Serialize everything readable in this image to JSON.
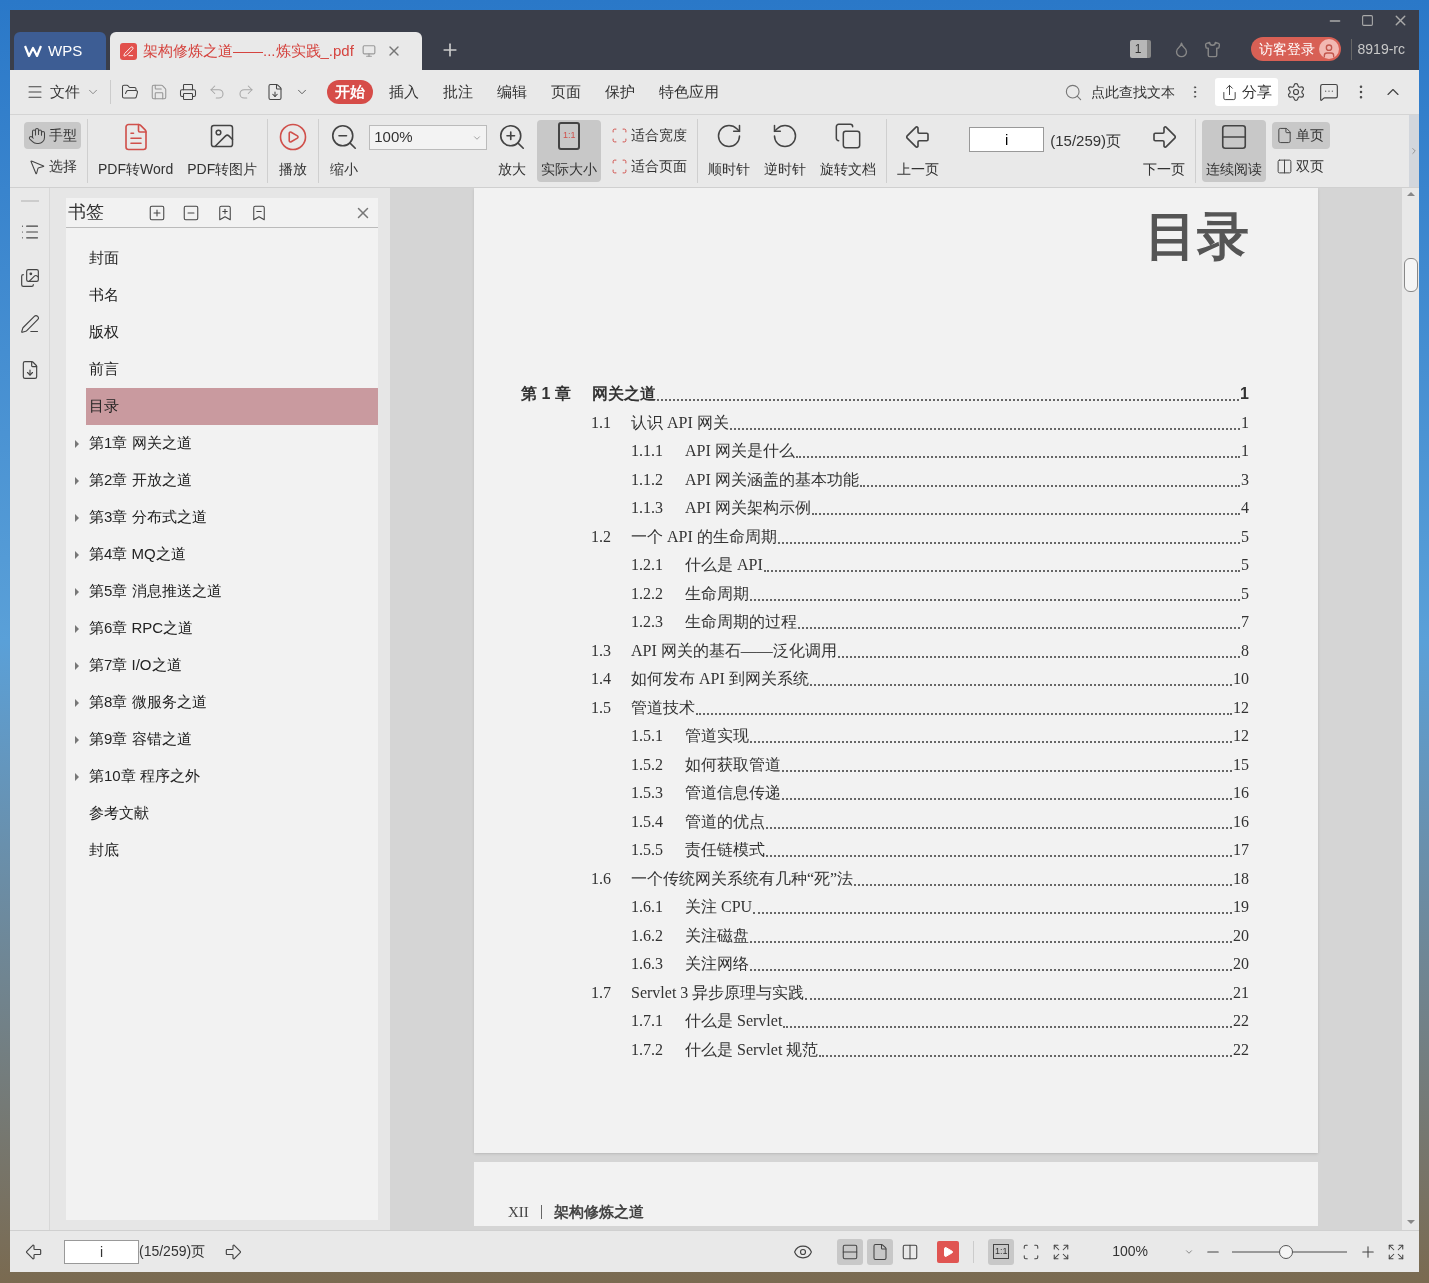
{
  "title_bar": {
    "tabs": [
      {
        "kind": "home",
        "label": "WPS",
        "selected": false
      },
      {
        "kind": "document",
        "label": "架构修炼之道——...炼实践_.pdf",
        "selected": true
      }
    ],
    "badge": "1",
    "login": "访客登录",
    "user": "8919-rc"
  },
  "menu": {
    "file": "文件",
    "tabs": [
      {
        "label": "开始",
        "selected": true
      },
      {
        "label": "插入",
        "selected": false
      },
      {
        "label": "批注",
        "selected": false
      },
      {
        "label": "编辑",
        "selected": false
      },
      {
        "label": "页面",
        "selected": false
      },
      {
        "label": "保护",
        "selected": false
      },
      {
        "label": "特色应用",
        "selected": false
      }
    ],
    "search": {
      "placeholder": "点此查找文本"
    },
    "share": "分享"
  },
  "toolbar": {
    "hand": {
      "label": "手型",
      "selected": true
    },
    "select": {
      "label": "选择",
      "selected": false
    },
    "to_word": "PDF转Word",
    "to_image": "PDF转图片",
    "play": "播放",
    "zoom_out": "缩小",
    "zoom_value": "100%",
    "zoom_in": "放大",
    "actual_size": {
      "label": "实际大小",
      "selected": true,
      "icon_text": "1:1"
    },
    "fit_width": "适合宽度",
    "fit_page": "适合页面",
    "clockwise": "顺时针",
    "counterclockwise": "逆时针",
    "rotate_doc": "旋转文档",
    "prev": "上一页",
    "page_value": "i",
    "page_count": "(15/259)页",
    "next": "下一页",
    "continuous": {
      "label": "连续阅读",
      "selected": true
    },
    "single": {
      "label": "单页",
      "selected": true
    },
    "double": {
      "label": "双页",
      "selected": false
    }
  },
  "bookmarks": {
    "title": "书签",
    "items": [
      {
        "label": "封面",
        "expandable": false,
        "selected": false
      },
      {
        "label": "书名",
        "expandable": false,
        "selected": false
      },
      {
        "label": "版权",
        "expandable": false,
        "selected": false
      },
      {
        "label": "前言",
        "expandable": false,
        "selected": false
      },
      {
        "label": "目录",
        "expandable": false,
        "selected": true
      },
      {
        "label": "第1章 网关之道",
        "expandable": true,
        "selected": false
      },
      {
        "label": "第2章 开放之道",
        "expandable": true,
        "selected": false
      },
      {
        "label": "第3章 分布式之道",
        "expandable": true,
        "selected": false
      },
      {
        "label": "第4章 MQ之道",
        "expandable": true,
        "selected": false
      },
      {
        "label": "第5章 消息推送之道",
        "expandable": true,
        "selected": false
      },
      {
        "label": "第6章 RPC之道",
        "expandable": true,
        "selected": false
      },
      {
        "label": "第7章 I/O之道",
        "expandable": true,
        "selected": false
      },
      {
        "label": "第8章 微服务之道",
        "expandable": true,
        "selected": false
      },
      {
        "label": "第9章 容错之道",
        "expandable": true,
        "selected": false
      },
      {
        "label": "第10章 程序之外",
        "expandable": true,
        "selected": false
      },
      {
        "label": "参考文献",
        "expandable": false,
        "selected": false
      },
      {
        "label": "封底",
        "expandable": false,
        "selected": false
      }
    ]
  },
  "page": {
    "title": "目录",
    "chapter": {
      "number": "第 1 章",
      "title": "网关之道",
      "page": "1",
      "children": [
        {
          "number": "1.1",
          "title": "认识 API 网关",
          "page": "1",
          "children": [
            {
              "number": "1.1.1",
              "title": "API 网关是什么",
              "page": "1"
            },
            {
              "number": "1.1.2",
              "title": "API 网关涵盖的基本功能",
              "page": "3"
            },
            {
              "number": "1.1.3",
              "title": "API 网关架构示例",
              "page": "4"
            }
          ]
        },
        {
          "number": "1.2",
          "title": "一个 API 的生命周期",
          "page": "5",
          "children": [
            {
              "number": "1.2.1",
              "title": "什么是 API",
              "page": "5"
            },
            {
              "number": "1.2.2",
              "title": "生命周期",
              "page": "5"
            },
            {
              "number": "1.2.3",
              "title": "生命周期的过程",
              "page": "7"
            }
          ]
        },
        {
          "number": "1.3",
          "title": "API 网关的基石——泛化调用",
          "page": "8"
        },
        {
          "number": "1.4",
          "title": "如何发布 API 到网关系统",
          "page": "10"
        },
        {
          "number": "1.5",
          "title": "管道技术",
          "page": "12",
          "children": [
            {
              "number": "1.5.1",
              "title": "管道实现",
              "page": "12"
            },
            {
              "number": "1.5.2",
              "title": "如何获取管道",
              "page": "15"
            },
            {
              "number": "1.5.3",
              "title": "管道信息传递",
              "page": "16"
            },
            {
              "number": "1.5.4",
              "title": "管道的优点",
              "page": "16"
            },
            {
              "number": "1.5.5",
              "title": "责任链模式",
              "page": "17"
            }
          ]
        },
        {
          "number": "1.6",
          "title": "一个传统网关系统有几种“死”法",
          "page": "18",
          "children": [
            {
              "number": "1.6.1",
              "title": "关注 CPU",
              "page": "19"
            },
            {
              "number": "1.6.2",
              "title": "关注磁盘",
              "page": "20"
            },
            {
              "number": "1.6.3",
              "title": "关注网络",
              "page": "20"
            }
          ]
        },
        {
          "number": "1.7",
          "title": "Servlet 3 异步原理与实践",
          "page": "21",
          "children": [
            {
              "number": "1.7.1",
              "title": "什么是 Servlet",
              "page": "22"
            },
            {
              "number": "1.7.2",
              "title": "什么是 Servlet 规范",
              "page": "22"
            }
          ]
        }
      ]
    }
  },
  "next_page": {
    "folio": "XII",
    "book_title": "架构修炼之道"
  },
  "status_bar": {
    "page_value": "i",
    "page_count": "(15/259)页",
    "views": [
      {
        "selected": true
      },
      {
        "selected": true
      },
      {
        "selected": false
      }
    ],
    "actual_size_selected": true,
    "actual_size_text": "1:1",
    "zoom": "100%",
    "zoom_slider": {
      "level": 0.47
    }
  }
}
